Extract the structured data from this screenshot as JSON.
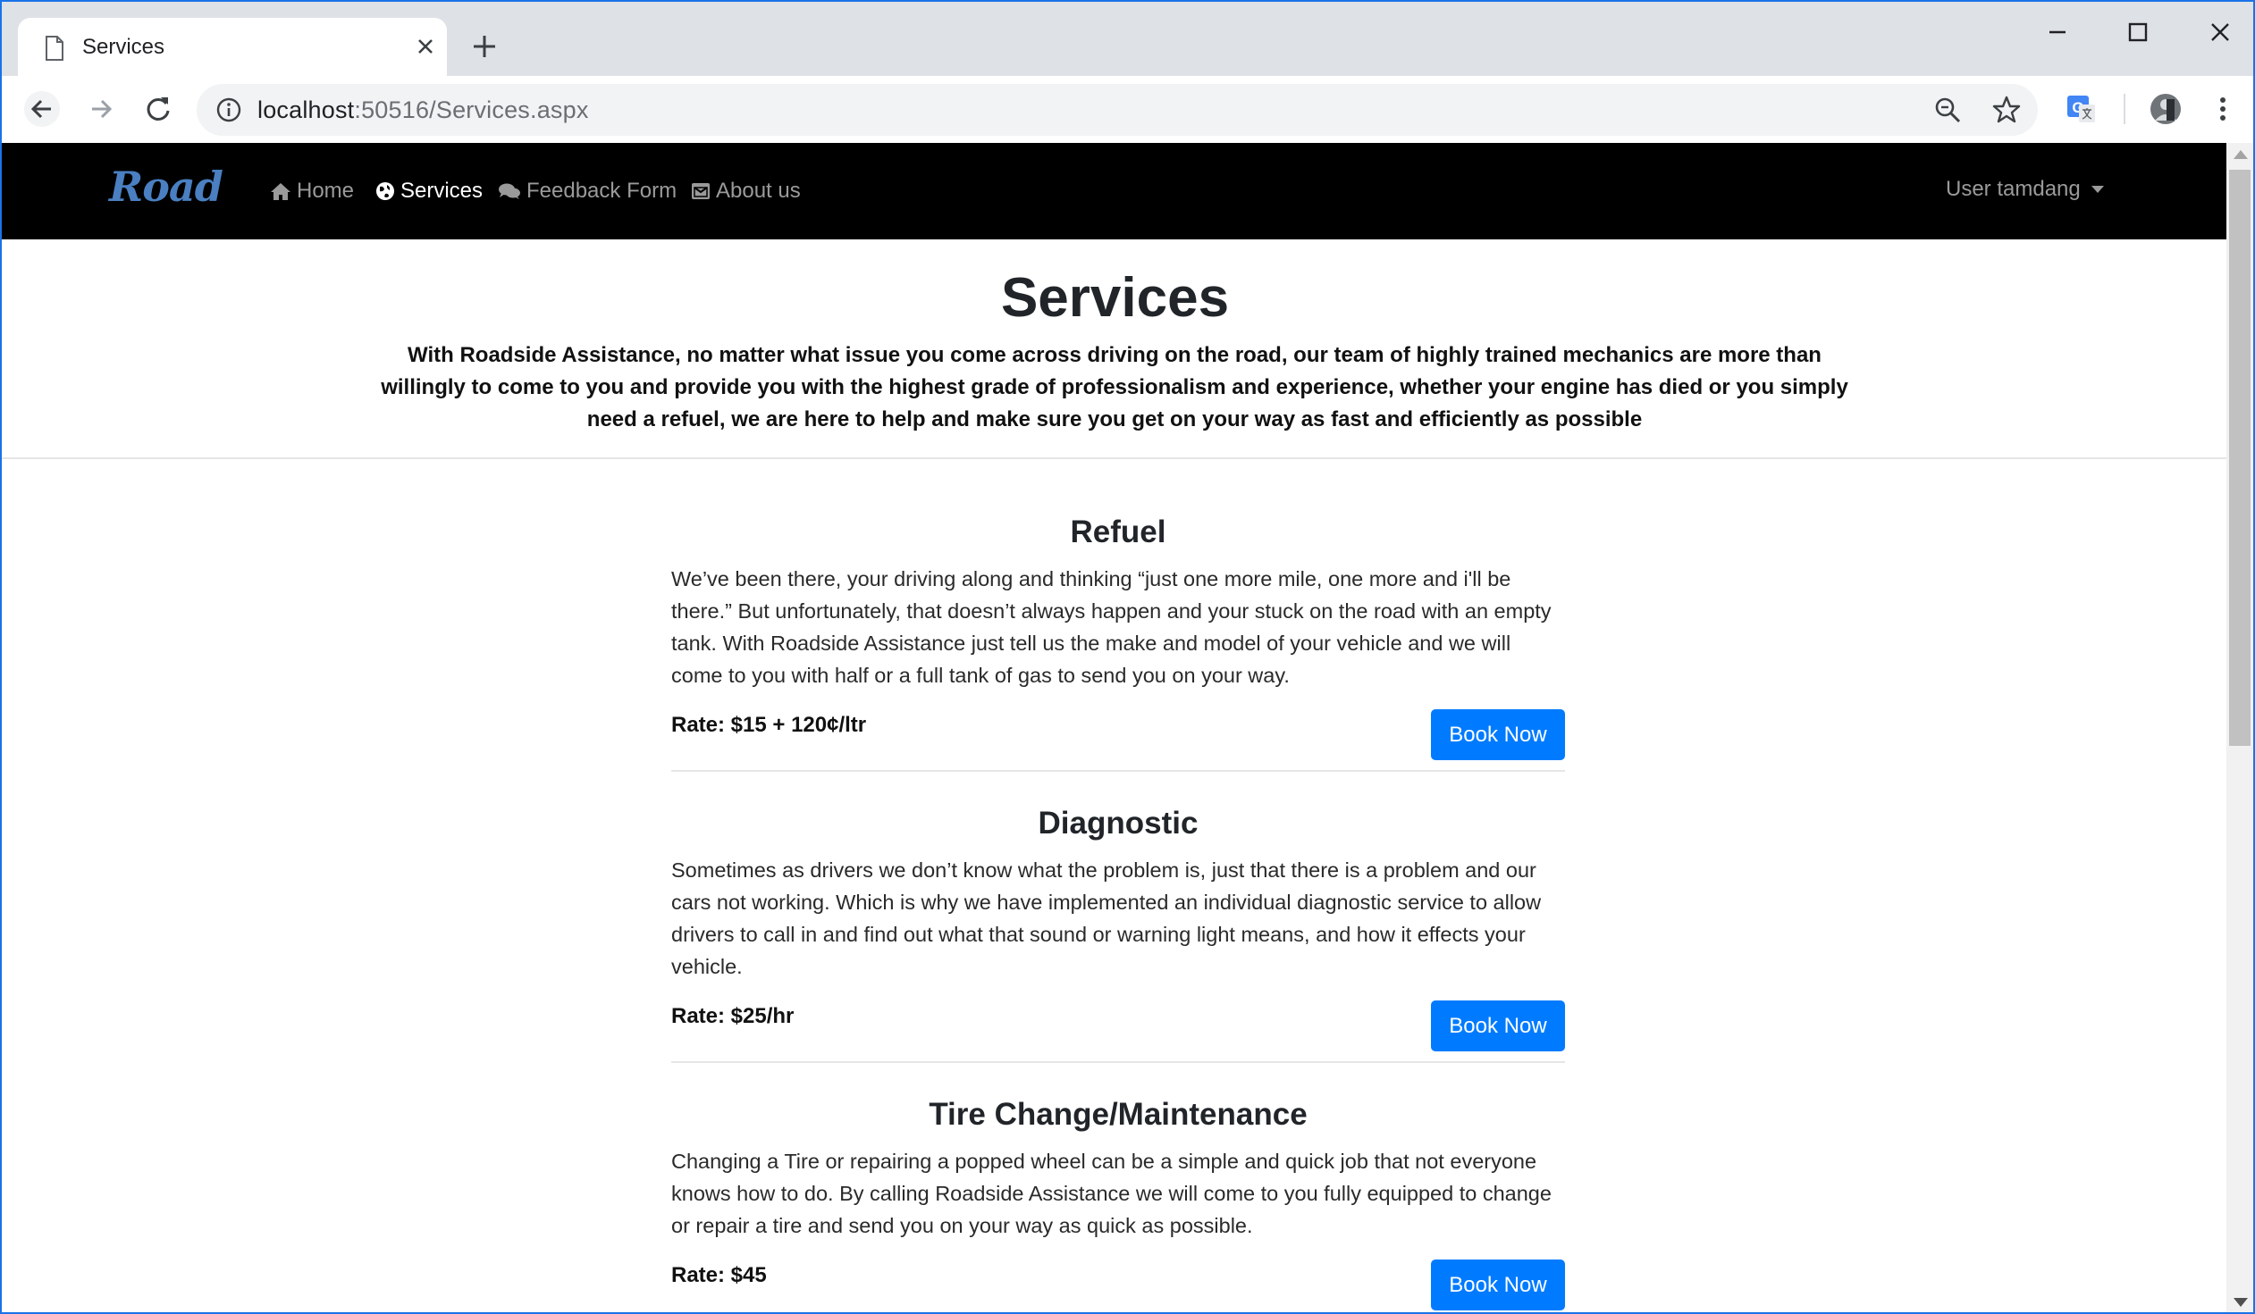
{
  "browser": {
    "tab_title": "Services",
    "url_host": "localhost",
    "url_rest": ":50516/Services.aspx"
  },
  "navbar": {
    "brand": "Road",
    "items": [
      {
        "label": "Home",
        "icon": "home-icon",
        "active": false
      },
      {
        "label": "Services",
        "icon": "globe-icon",
        "active": true
      },
      {
        "label": "Feedback Form",
        "icon": "comments-icon",
        "active": false
      },
      {
        "label": "About us",
        "icon": "envelope-icon",
        "active": false
      }
    ],
    "user_label": "User tamdang"
  },
  "hero": {
    "title": "Services",
    "intro": "With Roadside Assistance, no matter what issue you come across driving on the road, our team of highly trained mechanics are more than willingly to come to you and provide you with the highest grade of professionalism and experience, whether your engine has died or you simply need a refuel, we are here to help and make sure you get on your way as fast and efficiently as possible"
  },
  "services": [
    {
      "title": "Refuel",
      "description": "We’ve been there, your driving along and thinking “just one more mile, one more and i'll be there.” But unfortunately, that doesn’t always happen and your stuck on the road with an empty tank. With Roadside Assistance just tell us the make and model of your vehicle and we will come to you with half or a full tank of gas to send you on your way.",
      "rate": "Rate: $15 + 120¢/ltr",
      "button": "Book Now"
    },
    {
      "title": "Diagnostic",
      "description": "Sometimes as drivers we don’t know what the problem is, just that there is a problem and our cars not working. Which is why we have implemented an individual diagnostic service to allow drivers to call in and find out what that sound or warning light means, and how it effects your vehicle.",
      "rate": "Rate: $25/hr",
      "button": "Book Now"
    },
    {
      "title": "Tire Change/Maintenance",
      "description": "Changing a Tire or repairing a popped wheel can be a simple and quick job that not everyone knows how to do. By calling Roadside Assistance we will come to you fully equipped to change or repair a tire and send you on your way as quick as possible.",
      "rate": "Rate: $45",
      "button": "Book Now"
    }
  ],
  "colors": {
    "navbar_bg": "#000000",
    "brand": "#4a7fc1",
    "button": "#007bff",
    "accent_border": "#1a73e8"
  }
}
